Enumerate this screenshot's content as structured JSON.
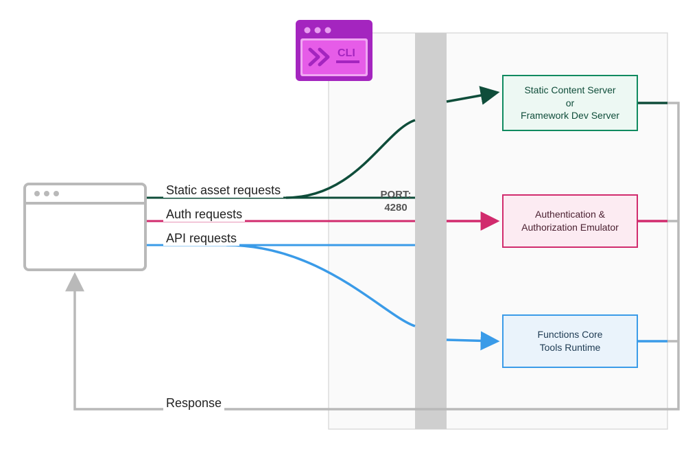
{
  "diagram": {
    "cli_badge": {
      "label": "CLI"
    },
    "port": {
      "label": "PORT:",
      "value": "4280"
    },
    "requests": {
      "static": "Static asset requests",
      "auth": "Auth requests",
      "api": "API requests"
    },
    "response_label": "Response",
    "services": {
      "static": {
        "line1": "Static Content Server",
        "line2": "or",
        "line3": "Framework  Dev  Server"
      },
      "auth": "Authentication & Authorization Emulator",
      "functions": {
        "line1": "Functions  Core",
        "line2": "Tools  Runtime"
      }
    }
  },
  "colors": {
    "dark_teal": "#0f4d3a",
    "magenta": "#d12b6d",
    "sky_blue": "#3a9be8",
    "blue_outline": "#3a9be8",
    "grey_line": "#b9b9b9",
    "grey_light": "#f5f5f5",
    "port_bar": "#cfcfcf",
    "cli_purple": "#a425bf",
    "cli_pink": "#e65ce8",
    "cli_light": "#f0a8f2",
    "teal_fill": "#edf8f3",
    "pink_fill": "#fcebf2",
    "blue_fill": "#eaf3fb"
  }
}
